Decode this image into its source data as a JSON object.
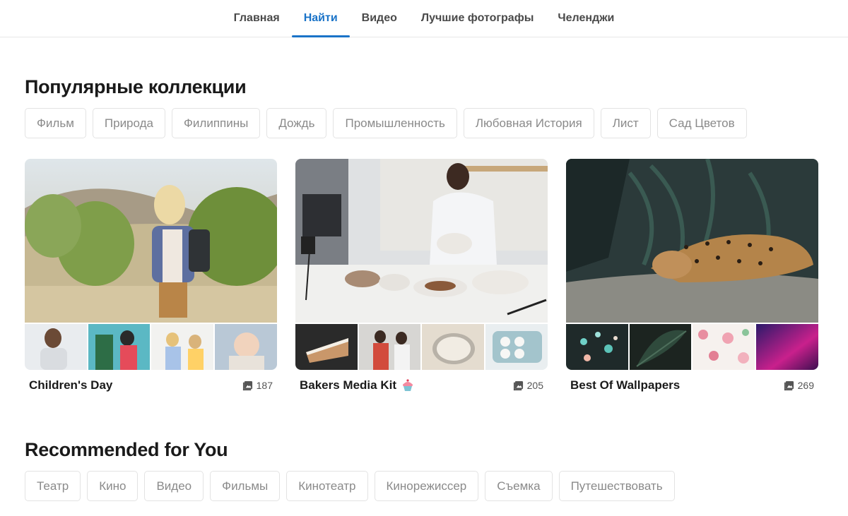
{
  "nav": {
    "tabs": [
      {
        "label": "Главная"
      },
      {
        "label": "Найти",
        "active": true
      },
      {
        "label": "Видео"
      },
      {
        "label": "Лучшие фотографы"
      },
      {
        "label": "Челенджи"
      }
    ]
  },
  "popular": {
    "title": "Популярные коллекции",
    "chips": [
      "Фильм",
      "Природа",
      "Филиппины",
      "Дождь",
      "Промышленность",
      "Любовная История",
      "Лист",
      "Сад Цветов"
    ],
    "collections": [
      {
        "name": "Children's Day",
        "count": "187",
        "icon": "photo-icon"
      },
      {
        "name": "Bakers Media Kit",
        "count": "205",
        "icon": "photo-icon",
        "emoji_icon": "cupcake-icon"
      },
      {
        "name": "Best Of Wallpapers",
        "count": "269",
        "icon": "photo-icon"
      }
    ]
  },
  "recommended": {
    "title": "Recommended for You",
    "chips": [
      "Театр",
      "Кино",
      "Видео",
      "Фильмы",
      "Кинотеатр",
      "Кинорежиссер",
      "Съемка",
      "Путешествовать"
    ]
  },
  "colors": {
    "accent": "#1a73c8",
    "chip_text": "#8a8a8a",
    "chip_border": "#e3e3e3"
  }
}
